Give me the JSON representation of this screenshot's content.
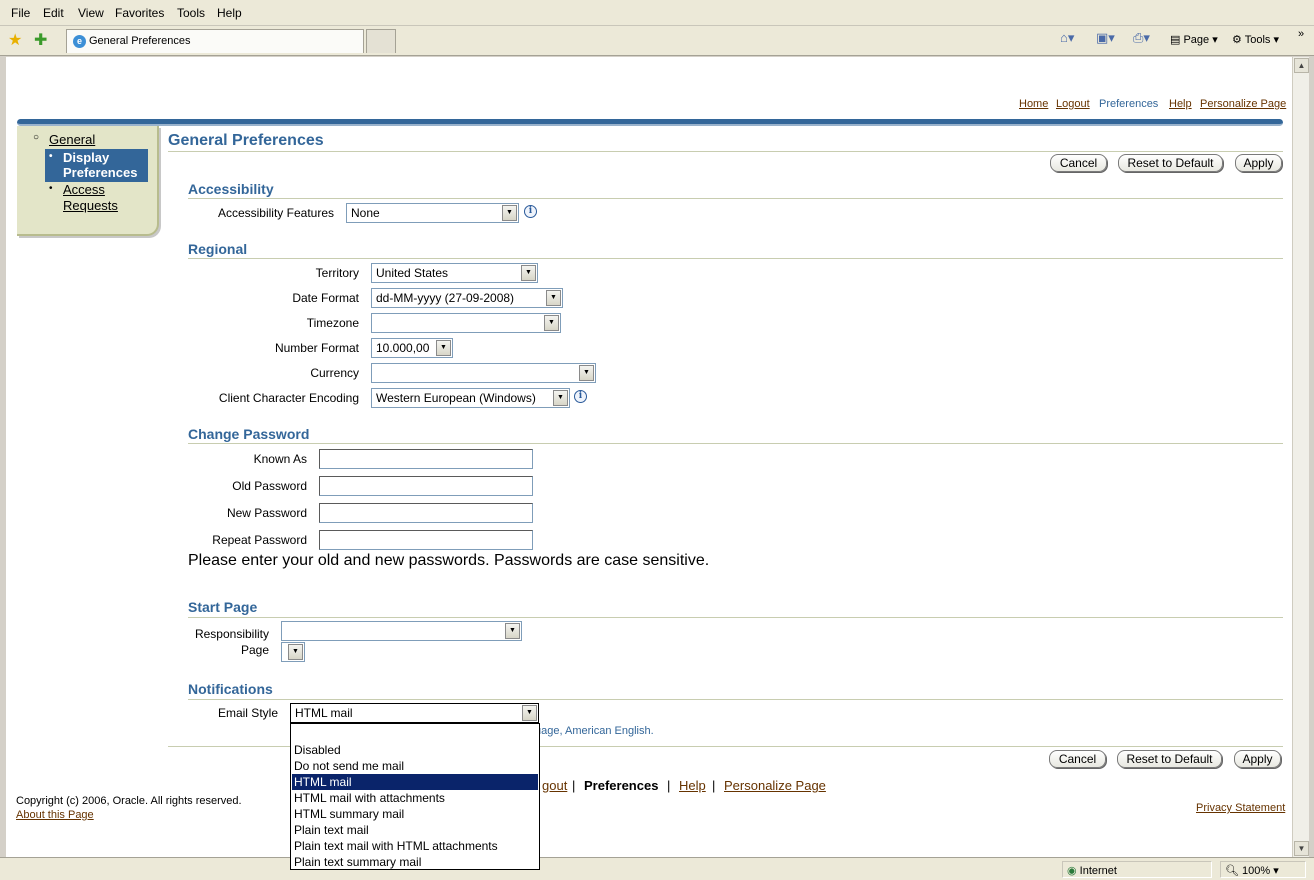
{
  "browser": {
    "menu": [
      "File",
      "Edit",
      "View",
      "Favorites",
      "Tools",
      "Help"
    ],
    "tab_title": "General Preferences",
    "command_page": "Page",
    "command_tools": "Tools",
    "status_zone": "Internet",
    "zoom": "100%"
  },
  "global_links": {
    "home": "Home",
    "logout": "Logout",
    "preferences": "Preferences",
    "help": "Help",
    "personalize": "Personalize Page"
  },
  "sidenav": {
    "general": "General",
    "display_line1": "Display",
    "display_line2": "Preferences",
    "access_line1": "Access",
    "access_line2": "Requests"
  },
  "page": {
    "title": "General Preferences",
    "cancel": "Cancel",
    "reset": "Reset to Default",
    "apply": "Apply"
  },
  "accessibility": {
    "heading": "Accessibility",
    "features_label": "Accessibility Features",
    "features_value": "None"
  },
  "regional": {
    "heading": "Regional",
    "territory_label": "Territory",
    "territory_value": "United States",
    "date_label": "Date Format",
    "date_value": "dd-MM-yyyy (27-09-2008)",
    "timezone_label": "Timezone",
    "timezone_value": "",
    "number_label": "Number Format",
    "number_value": "10.000,00",
    "currency_label": "Currency",
    "currency_value": "",
    "encoding_label": "Client Character Encoding",
    "encoding_value": "Western European (Windows)"
  },
  "password": {
    "heading": "Change Password",
    "known_label": "Known As",
    "old_label": "Old Password",
    "new_label": "New Password",
    "repeat_label": "Repeat Password",
    "hint": "Please enter your old and new passwords. Passwords are case sensitive."
  },
  "start_page": {
    "heading": "Start Page",
    "resp_label_1": "Responsibility",
    "page_label": "Page"
  },
  "notifications": {
    "heading": "Notifications",
    "email_label": "Email Style",
    "email_value": "HTML mail",
    "note_visible": "uage, American English.",
    "options": [
      "",
      "Disabled",
      "Do not send me mail",
      "HTML mail",
      "HTML mail with attachments",
      "HTML summary mail",
      "Plain text mail",
      "Plain text mail with HTML attachments",
      "Plain text summary mail"
    ]
  },
  "footer": {
    "logout_partial": "gout",
    "preferences": "Preferences",
    "help": "Help",
    "personalize": "Personalize Page",
    "copyright": "Copyright (c) 2006, Oracle. All rights reserved.",
    "about": "About this Page",
    "privacy": "Privacy Statement"
  }
}
